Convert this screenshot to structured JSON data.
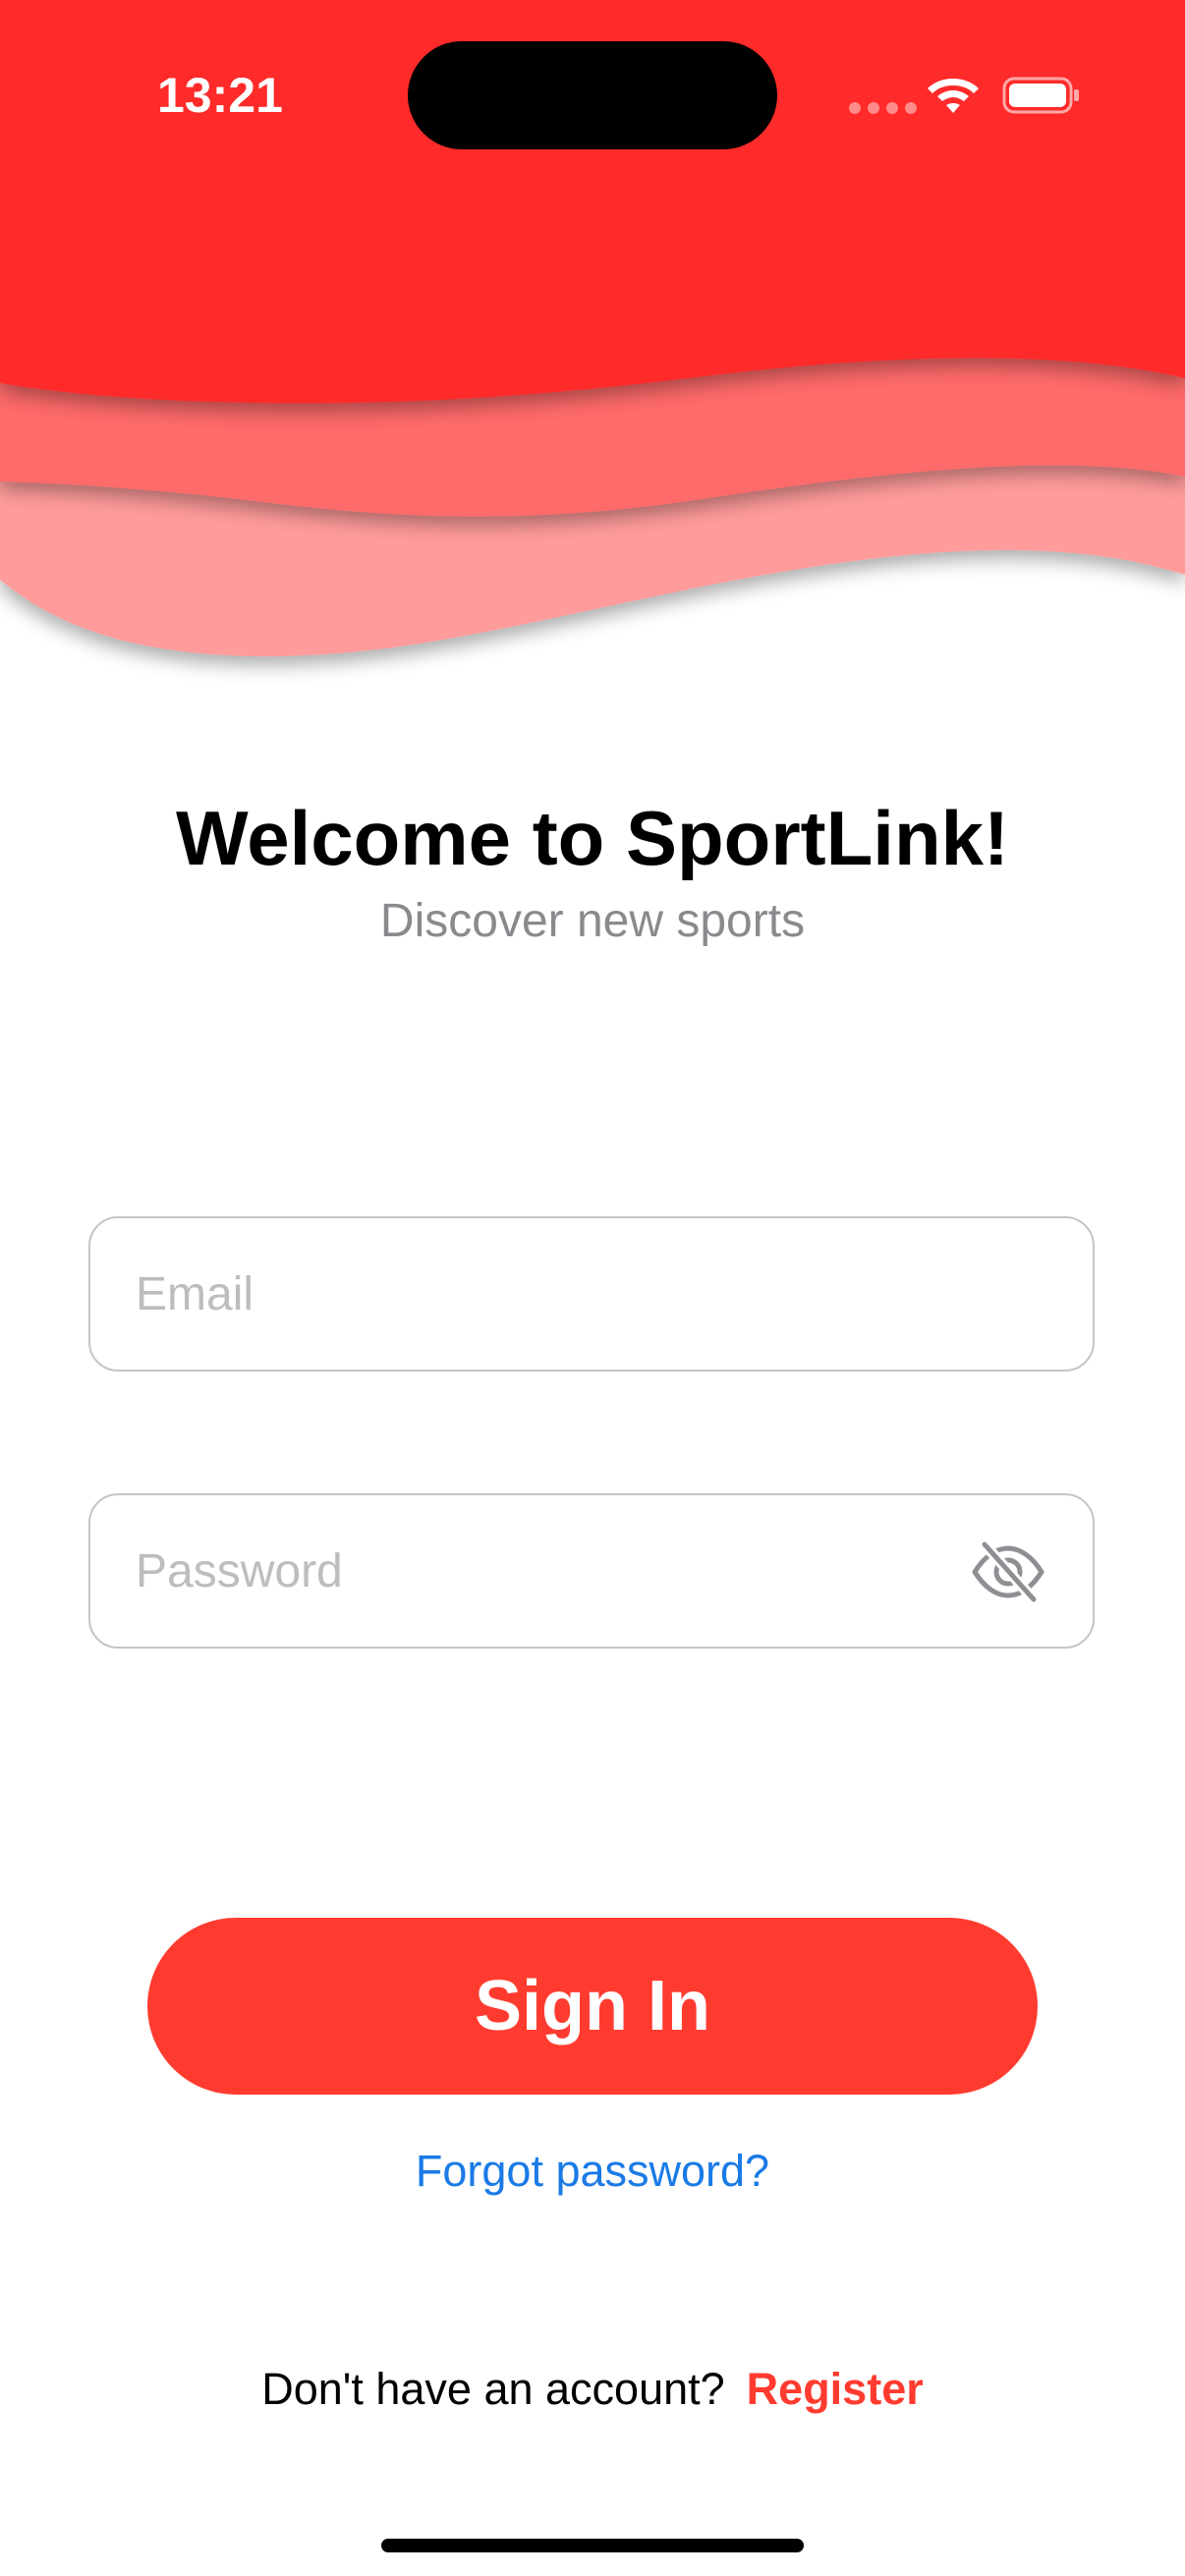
{
  "status_bar": {
    "time": "13:21"
  },
  "welcome": {
    "title": "Welcome to SportLink!",
    "subtitle": "Discover new sports"
  },
  "form": {
    "email_placeholder": "Email",
    "password_placeholder": "Password",
    "sign_in_label": "Sign In",
    "forgot_label": "Forgot password?"
  },
  "register": {
    "prompt": "Don't have an account?",
    "link_label": "Register"
  },
  "colors": {
    "brand_red": "#ff2a2a",
    "button_red": "#ff3b30",
    "link_blue": "#1a7ae6"
  },
  "icons": {
    "password_toggle": "eye-slash-icon",
    "wifi": "wifi-icon",
    "battery": "battery-icon"
  }
}
